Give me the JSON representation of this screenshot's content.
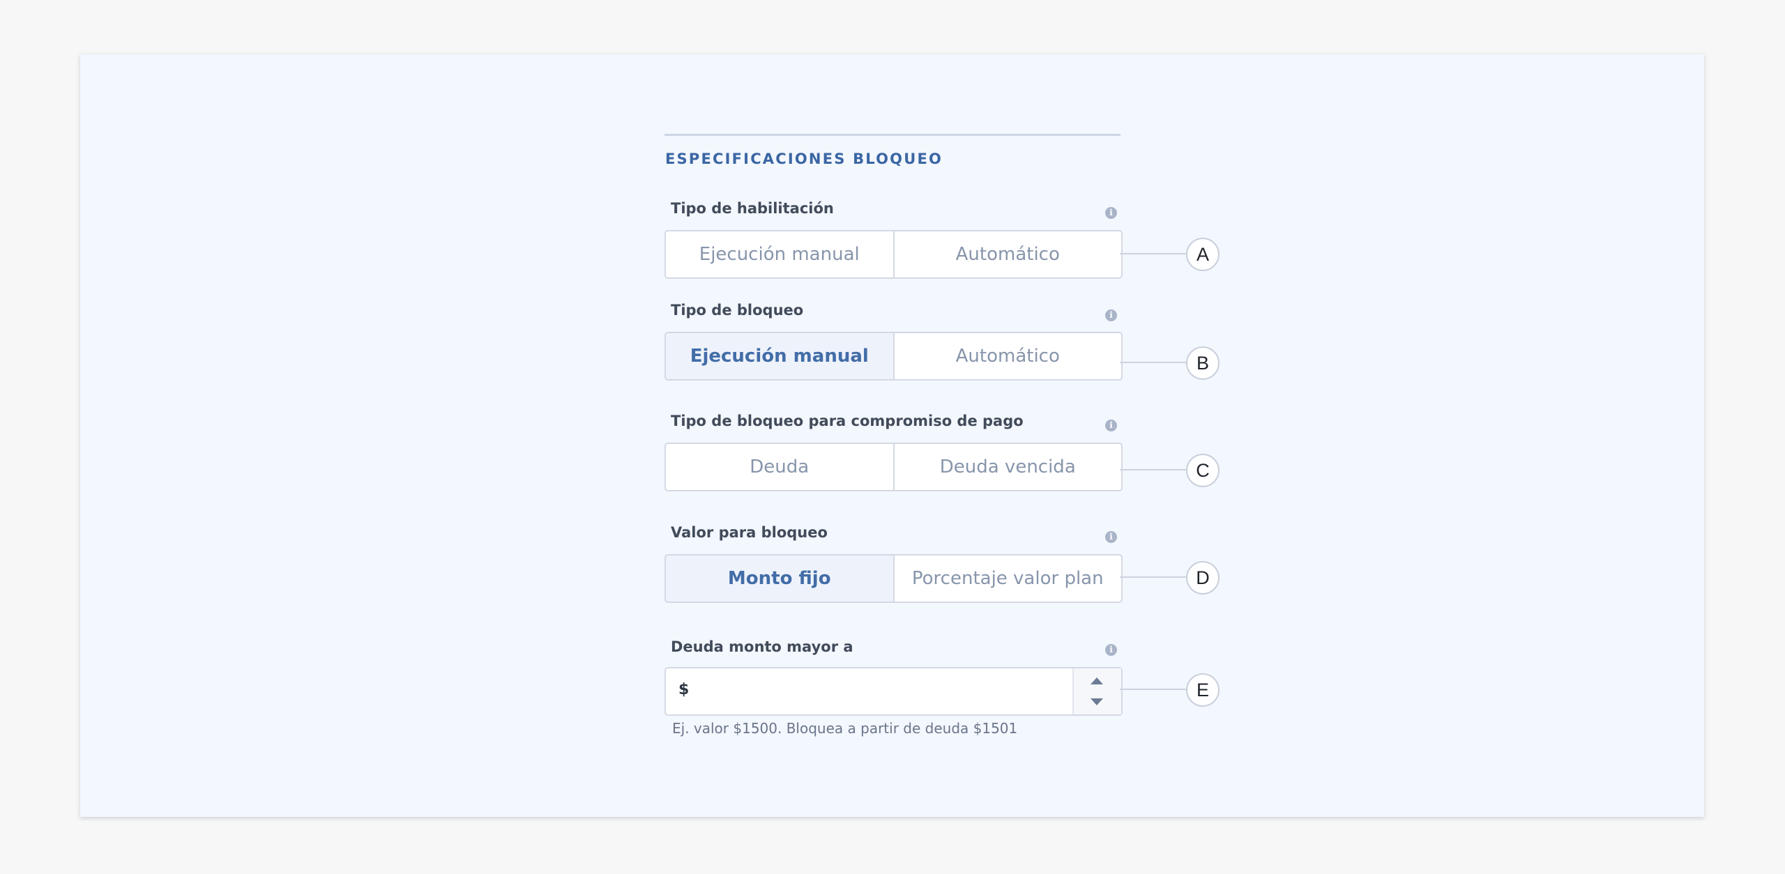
{
  "section": {
    "title": "ESPECIFICACIONES BLOQUEO"
  },
  "fields": [
    {
      "label": "Tipo de habilitación",
      "options": [
        "Ejecución manual",
        "Automático"
      ],
      "selected_index": null,
      "callout": "A"
    },
    {
      "label": "Tipo de bloqueo",
      "options": [
        "Ejecución manual",
        "Automático"
      ],
      "selected_index": 0,
      "callout": "B"
    },
    {
      "label": "Tipo de bloqueo para compromiso de pago",
      "options": [
        "Deuda",
        "Deuda vencida"
      ],
      "selected_index": null,
      "callout": "C"
    },
    {
      "label": "Valor para bloqueo",
      "options": [
        "Monto fijo",
        "Porcentaje valor plan"
      ],
      "selected_index": 0,
      "callout": "D"
    }
  ],
  "amount_field": {
    "label": "Deuda monto mayor a",
    "prefix": "$",
    "value": "",
    "helper": "Ej. valor $1500. Bloquea a partir de deuda $1501",
    "callout": "E"
  },
  "icons": {
    "info": "info-icon",
    "info_glyph": "i",
    "stepper_up": "chevron-up-icon",
    "stepper_down": "chevron-down-icon"
  },
  "colors": {
    "accent": "#3a66a3",
    "selected_background": "#eef2fa",
    "panel_background": "#f3f7fe",
    "border": "#d3d9e4"
  }
}
